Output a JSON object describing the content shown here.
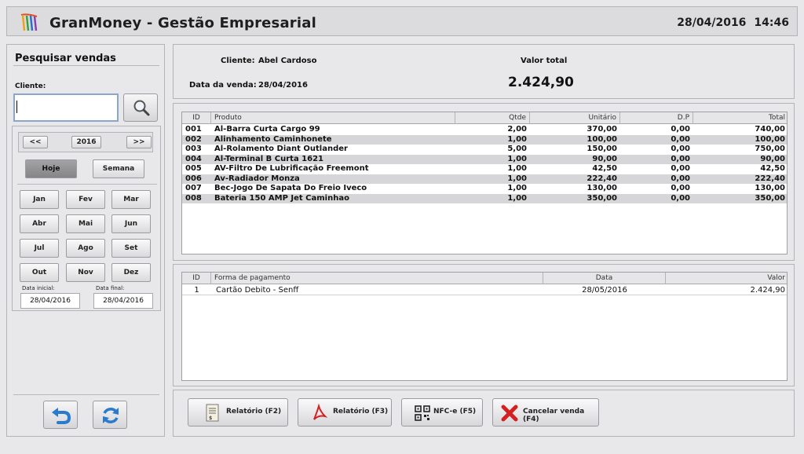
{
  "header": {
    "app_title": "GranMoney - Gestão Empresarial",
    "date": "28/04/2016",
    "time": "14:46"
  },
  "sidebar": {
    "title": "Pesquisar vendas",
    "cliente_label": "Cliente:",
    "cliente_value": "",
    "prev_label": "<<",
    "year": "2016",
    "next_label": ">>",
    "hoje_label": "Hoje",
    "semana_label": "Semana",
    "months": [
      "Jan",
      "Fev",
      "Mar",
      "Abr",
      "Mai",
      "Jun",
      "Jul",
      "Ago",
      "Set",
      "Out",
      "Nov",
      "Dez"
    ],
    "data_inicial_label": "Data inicial:",
    "data_inicial": "28/04/2016",
    "data_final_label": "Data final:",
    "data_final": "28/04/2016"
  },
  "summary": {
    "cliente_label": "Cliente:",
    "cliente_value": "Abel Cardoso",
    "data_label": "Data da venda:",
    "data_value": "28/04/2016",
    "valor_total_label": "Valor total",
    "valor_total": "2.424,90"
  },
  "products": {
    "columns": [
      "ID",
      "Produto",
      "Qtde",
      "Unitário",
      "D.P",
      "Total"
    ],
    "rows": [
      [
        "001",
        "Al-Barra Curta Cargo 99",
        "2,00",
        "370,00",
        "0,00",
        "740,00"
      ],
      [
        "002",
        "Alinhamento Caminhonete",
        "1,00",
        "100,00",
        "0,00",
        "100,00"
      ],
      [
        "003",
        "Al-Rolamento Diant Outlander",
        "5,00",
        "150,00",
        "0,00",
        "750,00"
      ],
      [
        "004",
        "Al-Terminal B Curta 1621",
        "1,00",
        "90,00",
        "0,00",
        "90,00"
      ],
      [
        "005",
        "AV-Filtro De Lubrificação Freemont",
        "1,00",
        "42,50",
        "0,00",
        "42,50"
      ],
      [
        "006",
        "Av-Radiador Monza",
        "1,00",
        "222,40",
        "0,00",
        "222,40"
      ],
      [
        "007",
        "Bec-Jogo De Sapata Do Freio Iveco",
        "1,00",
        "130,00",
        "0,00",
        "130,00"
      ],
      [
        "008",
        "Bateria 150 AMP Jet Caminhao",
        "1,00",
        "350,00",
        "0,00",
        "350,00"
      ]
    ]
  },
  "payments": {
    "columns": [
      "ID",
      "Forma de pagamento",
      "Data",
      "Valor"
    ],
    "rows": [
      [
        "1",
        "Cartão Debito - Senff",
        "28/05/2016",
        "2.424,90"
      ]
    ]
  },
  "actions": {
    "relatorio_f2": "Relatório (F2)",
    "relatorio_f3": "Relatório (F3)",
    "nfce_f5": "NFC-e (F5)",
    "cancelar_f4": "Cancelar venda (F4)"
  },
  "colors": {
    "selected_button": "#939396",
    "row_alt": "#d6d6d8",
    "cancel_red": "#d42020",
    "refresh_blue": "#2a7ad0"
  }
}
